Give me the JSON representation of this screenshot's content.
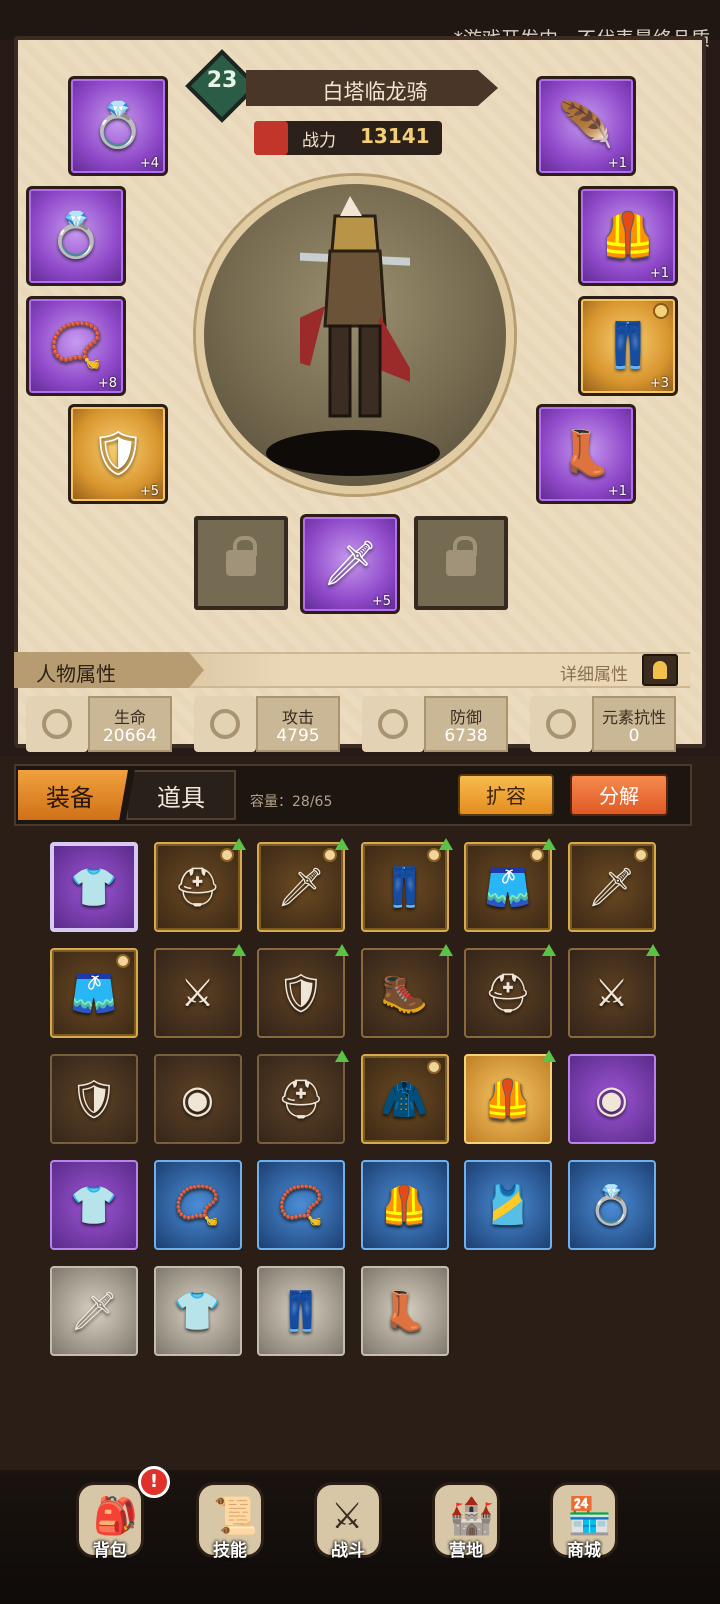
{
  "disclaimer": "*游戏开发中，不代表最终品质",
  "hero": {
    "level": "23",
    "name": "白塔临龙骑",
    "power_label": "战力",
    "power_value": "13141"
  },
  "equipped": {
    "left": [
      {
        "icon": "ring-icon",
        "quality": "purple",
        "plus": "+4"
      },
      {
        "icon": "ring-icon",
        "quality": "purple",
        "plus": ""
      },
      {
        "icon": "amulet-icon",
        "quality": "purple",
        "plus": "+8"
      },
      {
        "icon": "shield-icon",
        "quality": "gold",
        "plus": "+5"
      }
    ],
    "right": [
      {
        "icon": "feather-hat-icon",
        "quality": "purple",
        "plus": "+1"
      },
      {
        "icon": "chest-armor-icon",
        "quality": "purple",
        "plus": "+1"
      },
      {
        "icon": "pants-icon",
        "quality": "gold",
        "plus": "+3"
      },
      {
        "icon": "boots-icon",
        "quality": "purple",
        "plus": "+1"
      }
    ],
    "weapon": {
      "icon": "sword-icon",
      "quality": "purple",
      "plus": "+5"
    }
  },
  "attributes": {
    "title": "人物属性",
    "detail_label": "详细属性",
    "stats": [
      {
        "label": "生命",
        "value": "20664",
        "icon": "heart-icon"
      },
      {
        "label": "攻击",
        "value": "4795",
        "icon": "sword-attack-icon"
      },
      {
        "label": "防御",
        "value": "6738",
        "icon": "shield-defense-icon"
      },
      {
        "label": "元素抗性",
        "value": "0",
        "icon": "element-icon"
      }
    ]
  },
  "inventory": {
    "tab_equipment": "装备",
    "tab_items": "道具",
    "capacity": "容量：28/65",
    "expand_label": "扩容",
    "decompose_label": "分解",
    "items": [
      {
        "icon": "tunic-icon",
        "quality": "purplesel",
        "up": false,
        "shield": false
      },
      {
        "icon": "helmet-icon",
        "quality": "gold",
        "up": true,
        "shield": true
      },
      {
        "icon": "sword-icon",
        "quality": "gold",
        "up": true,
        "shield": true
      },
      {
        "icon": "pants-icon",
        "quality": "gold",
        "up": true,
        "shield": true
      },
      {
        "icon": "leg-armor-icon",
        "quality": "gold",
        "up": true,
        "shield": true
      },
      {
        "icon": "sword-icon",
        "quality": "gold",
        "up": false,
        "shield": true
      },
      {
        "icon": "leg-armor-icon",
        "quality": "gold",
        "up": false,
        "shield": true
      },
      {
        "icon": "dark-sword-icon",
        "quality": "golddark",
        "up": true,
        "shield": false
      },
      {
        "icon": "dark-shield-icon",
        "quality": "golddark",
        "up": true,
        "shield": false
      },
      {
        "icon": "gold-boots-icon",
        "quality": "golddark",
        "up": true,
        "shield": false
      },
      {
        "icon": "helmet-icon",
        "quality": "golddark",
        "up": true,
        "shield": false
      },
      {
        "icon": "dark-sword-icon",
        "quality": "golddark",
        "up": true,
        "shield": false
      },
      {
        "icon": "kite-shield-icon",
        "quality": "brown",
        "up": false,
        "shield": false
      },
      {
        "icon": "round-shield-icon",
        "quality": "brown",
        "up": false,
        "shield": false
      },
      {
        "icon": "helmet-icon",
        "quality": "brown",
        "up": true,
        "shield": false
      },
      {
        "icon": "cloak-icon",
        "quality": "gold",
        "up": false,
        "shield": true
      },
      {
        "icon": "gold-armor-icon",
        "quality": "goldhi",
        "up": true,
        "shield": false
      },
      {
        "icon": "round-shield-icon",
        "quality": "purple",
        "up": false,
        "shield": false
      },
      {
        "icon": "tunic-icon",
        "quality": "purple",
        "up": false,
        "shield": false
      },
      {
        "icon": "amulet-icon",
        "quality": "blue",
        "up": false,
        "shield": false
      },
      {
        "icon": "amulet-icon",
        "quality": "blue",
        "up": false,
        "shield": false
      },
      {
        "icon": "chest-armor-icon",
        "quality": "blue",
        "up": false,
        "shield": false
      },
      {
        "icon": "belt-armor-icon",
        "quality": "blue",
        "up": false,
        "shield": false
      },
      {
        "icon": "ring-icon",
        "quality": "blue",
        "up": false,
        "shield": false
      },
      {
        "icon": "sword-icon",
        "quality": "gray",
        "up": false,
        "shield": false
      },
      {
        "icon": "tunic-icon",
        "quality": "gray",
        "up": false,
        "shield": false
      },
      {
        "icon": "pants-icon",
        "quality": "gray",
        "up": false,
        "shield": false
      },
      {
        "icon": "boots-icon",
        "quality": "gray",
        "up": false,
        "shield": false
      }
    ]
  },
  "nav": [
    {
      "label": "背包",
      "icon": "backpack-icon",
      "badge": "!"
    },
    {
      "label": "技能",
      "icon": "skills-icon"
    },
    {
      "label": "战斗",
      "icon": "battle-icon"
    },
    {
      "label": "营地",
      "icon": "camp-icon"
    },
    {
      "label": "商城",
      "icon": "shop-icon"
    }
  ]
}
